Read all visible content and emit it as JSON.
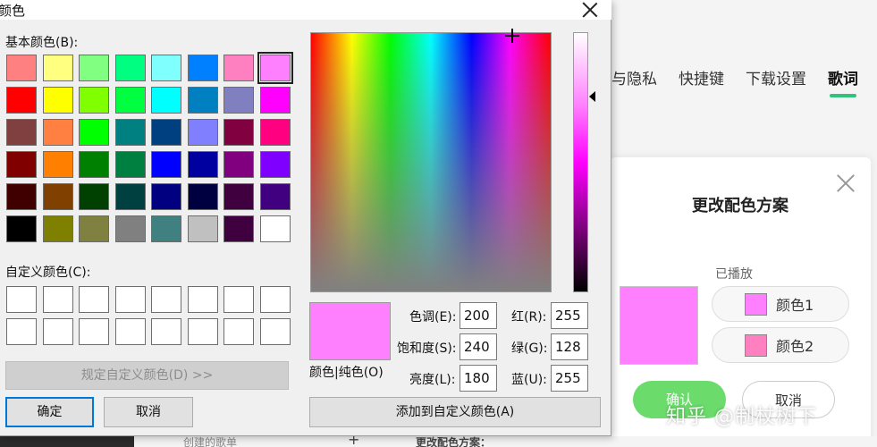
{
  "background_app": {
    "tabs": [
      {
        "label": "与隐私"
      },
      {
        "label": "快捷键"
      },
      {
        "label": "下载设置"
      },
      {
        "label": "歌词",
        "active": true
      }
    ],
    "scheme_panel": {
      "title": "更改配色方案",
      "played_label": "已播放",
      "preview_color": "#ff80ff",
      "color1_label": "颜色1",
      "color1_swatch": "#ff80ff",
      "color2_label": "颜色2",
      "color2_swatch": "#ff80c0",
      "confirm_label": "确认",
      "cancel_label": "取消",
      "accent_color": "#31c27c"
    },
    "bottom": {
      "playlist_text": "创建的歌单",
      "plus": "+",
      "scheme_text": "更改配色方案："
    },
    "watermark": "知乎 @制杖树下"
  },
  "dialog": {
    "title": "颜色",
    "basic_colors_label": "基本颜色(B):",
    "basic_colors": [
      "#ff8080",
      "#ffff80",
      "#80ff80",
      "#00ff80",
      "#80ffff",
      "#0080ff",
      "#ff80c0",
      "#ff80ff",
      "#ff0000",
      "#ffff00",
      "#80ff00",
      "#00ff40",
      "#00ffff",
      "#0080c0",
      "#8080c0",
      "#ff00ff",
      "#804040",
      "#ff8040",
      "#00ff00",
      "#008080",
      "#004080",
      "#8080ff",
      "#800040",
      "#ff0080",
      "#800000",
      "#ff8000",
      "#008000",
      "#008040",
      "#0000ff",
      "#0000a0",
      "#800080",
      "#8000ff",
      "#400000",
      "#804000",
      "#004000",
      "#004040",
      "#000080",
      "#000040",
      "#400040",
      "#400080",
      "#000000",
      "#808000",
      "#808040",
      "#808080",
      "#408080",
      "#c0c0c0",
      "#400040",
      "#ffffff"
    ],
    "selected_basic_index": 7,
    "custom_colors_label": "自定义颜色(C):",
    "custom_colors": [
      "#ffffff",
      "#ffffff",
      "#ffffff",
      "#ffffff",
      "#ffffff",
      "#ffffff",
      "#ffffff",
      "#ffffff",
      "#ffffff",
      "#ffffff",
      "#ffffff",
      "#ffffff",
      "#ffffff",
      "#ffffff",
      "#ffffff",
      "#ffffff"
    ],
    "define_custom_button": "规定自定义颜色(D) >>",
    "ok_button": "确定",
    "cancel_button": "取消",
    "add_custom_button": "添加到自定义颜色(A)",
    "color_solid_label": "颜色|纯色(O)",
    "current_color": "#ff80ff",
    "hue_label": "色调(E):",
    "hue_value": "200",
    "sat_label": "饱和度(S):",
    "sat_value": "240",
    "lum_label": "亮度(L):",
    "lum_value": "180",
    "red_label": "红(R):",
    "red_value": "255",
    "green_label": "绿(G):",
    "green_value": "128",
    "blue_label": "蓝(U):",
    "blue_value": "255"
  }
}
